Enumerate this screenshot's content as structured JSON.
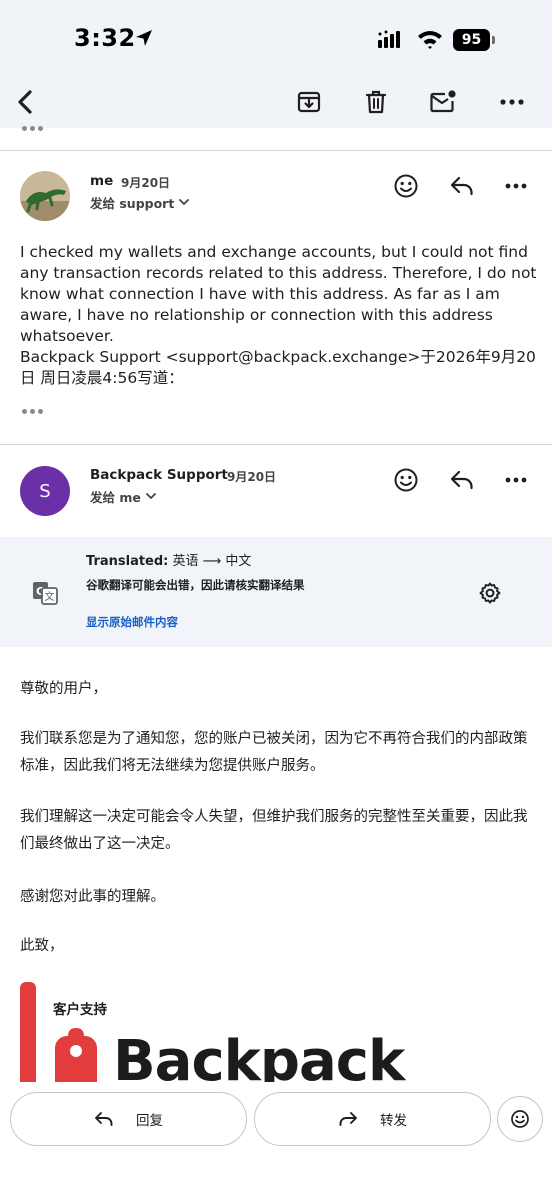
{
  "status_bar": {
    "time": "3:32",
    "battery": "95"
  },
  "thread": {
    "message_1": {
      "sender": "me",
      "date": "9月20日",
      "recipient": "发给 support",
      "body": "I checked my wallets and exchange accounts, but I could not find any transaction records related to this address. Therefore, I do not know what connection I have with this address. As far as I am aware, I have no relationship or connection with this address whatsoever.",
      "quote_header": "Backpack Support <support@backpack.exchange>于2026年9月20日 周日凌晨4:56写道："
    },
    "message_2": {
      "avatar_letter": "S",
      "sender": "Backpack Support",
      "date": "9月20日",
      "recipient": "发给 me"
    }
  },
  "translation": {
    "title_prefix": "Translated:",
    "languages": "英语 ⟶ 中文",
    "warning": "谷歌翻译可能会出错，因此请核实翻译结果",
    "show_original": "显示原始邮件内容"
  },
  "translated_body": {
    "greeting": "尊敬的用户，",
    "p1": "我们联系您是为了通知您，您的账户已被关闭，因为它不再符合我们的内部政策标准，因此我们将无法继续为您提供账户服务。",
    "p2": "我们理解这一决定可能会令人失望，但维护我们服务的完整性至关重要，因此我们最终做出了这一决定。",
    "p3": "感谢您对此事的理解。",
    "closing": "此致，"
  },
  "signature": {
    "label": "客户支持",
    "wordmark": "Backpack",
    "brand_color": "#e23c3c"
  },
  "bottom_bar": {
    "reply_label": "回复",
    "forward_label": "转发"
  },
  "icons": {
    "back": "back-chevron-icon",
    "archive": "archive-icon",
    "delete": "trash-icon",
    "mark_unread": "mark-unread-icon",
    "more": "more-horizontal-icon",
    "emoji": "emoji-icon",
    "reply": "reply-icon",
    "forward": "forward-icon",
    "translate": "translate-icon",
    "settings": "gear-icon"
  },
  "colors": {
    "accent_link": "#1a5fc7",
    "avatar_purple": "#6b2fa7",
    "header_bg": "#f0f3f8"
  }
}
